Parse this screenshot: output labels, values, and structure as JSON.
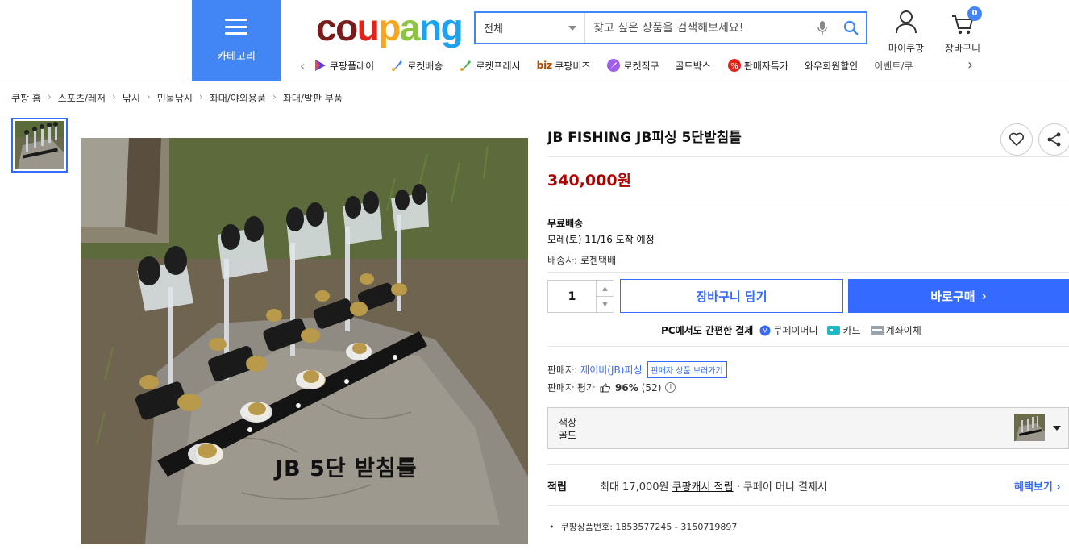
{
  "header": {
    "category_label": "카테고리",
    "logo_text": [
      "c",
      "o",
      "u",
      "p",
      "a",
      "n",
      "g"
    ],
    "search": {
      "scope": "전체",
      "placeholder": "찾고 싶은 상품을 검색해보세요!"
    },
    "mycoupang_label": "마이쿠팡",
    "cart_label": "장바구니",
    "cart_count": "0",
    "nav": [
      {
        "label": "쿠팡플레이",
        "icon": "play-icon"
      },
      {
        "label": "로켓배송",
        "icon": "rocket-icon"
      },
      {
        "label": "로켓프레시",
        "icon": "rocket-fresh-icon"
      },
      {
        "label": "쿠팡비즈",
        "icon": "biz-icon",
        "prefix": "biz"
      },
      {
        "label": "로켓직구",
        "icon": "rocket-global-icon"
      },
      {
        "label": "골드박스",
        "icon": ""
      },
      {
        "label": "판매자특가",
        "icon": "percent-badge-icon"
      },
      {
        "label": "와우회원할인",
        "icon": ""
      },
      {
        "label": "이벤트/쿠",
        "icon": ""
      }
    ]
  },
  "breadcrumb": [
    "쿠팡 홈",
    "스포츠/레저",
    "낚시",
    "민물낚시",
    "좌대/야외용품",
    "좌대/발판 부품"
  ],
  "product": {
    "title": "JB FISHING JB피싱 5단받침틀",
    "image_caption": "JB 5단 받침틀",
    "price": "340,000원",
    "shipping_type": "무료배송",
    "arrival": "모레(토) 11/16 도착 예정",
    "carrier": "배송사: 로젠택배",
    "quantity": "1",
    "add_to_cart": "장바구니 담기",
    "buy_now": "바로구매",
    "pay": {
      "lead": "PC에서도 간편한 결제",
      "methods": [
        "쿠페이머니",
        "카드",
        "계좌이체"
      ]
    },
    "seller_label": "판매자:",
    "seller_name": "제이비(JB)피싱",
    "seller_link": "판매자 상품 보러가기",
    "rating_label": "판매자 평가",
    "rating_pct": "96%",
    "rating_count": "(52)",
    "option": {
      "name": "색상",
      "value": "골드"
    },
    "reward_label": "적립",
    "reward_text_prefix": "최대 17,000원",
    "reward_link": "쿠팡캐시 적립",
    "reward_text_suffix": "· 쿠페이 머니 결제시",
    "benefit_link": "혜택보기",
    "product_id": "쿠팡상품번호: 1853577245 - 3150719897"
  },
  "colors": {
    "brand_blue": "#346aff",
    "category_blue": "#4285f4",
    "price_red": "#ae0000"
  }
}
